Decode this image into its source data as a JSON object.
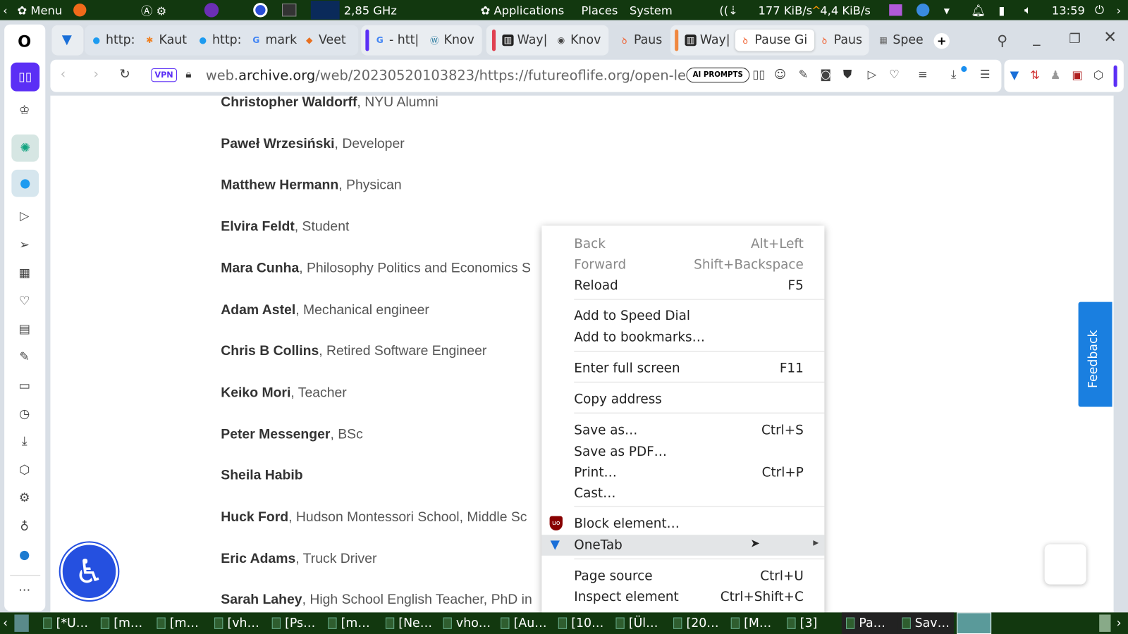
{
  "top_panel": {
    "menu": "Menu",
    "cpu": "2,85 GHz",
    "apps": "Applications",
    "places": "Places",
    "system": "System",
    "down": "177 KiB/s",
    "up": "4,4 KiB/s",
    "clock": "13:59"
  },
  "tabs": [
    {
      "label": "http:",
      "icon": "twitter"
    },
    {
      "label": "Kaut",
      "icon": "star"
    },
    {
      "label": "http:",
      "icon": "twitter"
    },
    {
      "label": "mark",
      "icon": "google"
    },
    {
      "label": "Veet",
      "icon": "fox"
    },
    {
      "label": "- htt|",
      "icon": "google"
    },
    {
      "label": "Knov",
      "icon": "wordpress"
    },
    {
      "label": "Way|",
      "icon": "archive"
    },
    {
      "label": "Knov",
      "icon": "globe"
    },
    {
      "label": "Paus",
      "icon": "flame"
    },
    {
      "label": "Way|",
      "icon": "archive"
    },
    {
      "label": "Pause Gi",
      "icon": "flame"
    },
    {
      "label": "Paus",
      "icon": "flame"
    },
    {
      "label": "Spee",
      "icon": "grid"
    }
  ],
  "address": {
    "vpn": "VPN",
    "url_pre": "web.",
    "url_domain": "archive.org",
    "url_post": "/web/20230520103823/https://futureoflife.org/open-le",
    "ai_prompts": "AI PROMPTS"
  },
  "people": [
    {
      "name": "Christopher Waldorff",
      "role": ", NYU Alumni"
    },
    {
      "name": "Paweł Wrzesiński",
      "role": ", Developer"
    },
    {
      "name": "Matthew Hermann",
      "role": ", Physican"
    },
    {
      "name": "Elvira Feldt",
      "role": ", Student"
    },
    {
      "name": "Mara Cunha",
      "role": ", Philosophy Politics and Economics S"
    },
    {
      "name": "Adam Astel",
      "role": ", Mechanical engineer"
    },
    {
      "name": "Chris B Collins",
      "role": ", Retired Software Engineer"
    },
    {
      "name": "Keiko Mori",
      "role": ", Teacher"
    },
    {
      "name": "Peter Messenger",
      "role": ", BSc"
    },
    {
      "name": "Sheila Habib",
      "role": ""
    },
    {
      "name": "Huck Ford",
      "role": ", Hudson Montessori School, Middle Sc"
    },
    {
      "name": "Eric Adams",
      "role": ", Truck Driver"
    },
    {
      "name": "Sarah Lahey",
      "role": ", High School English Teacher, PhD in"
    }
  ],
  "feedback": "Feedback",
  "menu": [
    {
      "label": "Back",
      "shortcut": "Alt+Left"
    },
    {
      "label": "Forward",
      "shortcut": "Shift+Backspace"
    },
    {
      "label": "Reload",
      "shortcut": "F5"
    },
    {
      "label": "Add to Speed Dial",
      "shortcut": ""
    },
    {
      "label": "Add to bookmarks…",
      "shortcut": ""
    },
    {
      "label": "Enter full screen",
      "shortcut": "F11"
    },
    {
      "label": "Copy address",
      "shortcut": ""
    },
    {
      "label": "Save as…",
      "shortcut": "Ctrl+S"
    },
    {
      "label": "Save as PDF…",
      "shortcut": ""
    },
    {
      "label": "Print…",
      "shortcut": "Ctrl+P"
    },
    {
      "label": "Cast…",
      "shortcut": ""
    },
    {
      "label": "Block element…",
      "shortcut": ""
    },
    {
      "label": "OneTab",
      "shortcut": ""
    },
    {
      "label": "Page source",
      "shortcut": "Ctrl+U"
    },
    {
      "label": "Inspect element",
      "shortcut": "Ctrl+Shift+C"
    }
  ],
  "taskbar": [
    "[*U…",
    "[m…",
    "[m…",
    "[vh…",
    "[Ps…",
    "[m…",
    "[Ne…",
    "vho…",
    "[Au…",
    "[10…",
    "[Ül…",
    "[20…",
    "[M…",
    "[3]",
    "Pa…",
    "Sav…"
  ],
  "colors": {
    "accent": "#5b2ff5",
    "panel": "#12380f",
    "feedback": "#1a7fe0"
  }
}
